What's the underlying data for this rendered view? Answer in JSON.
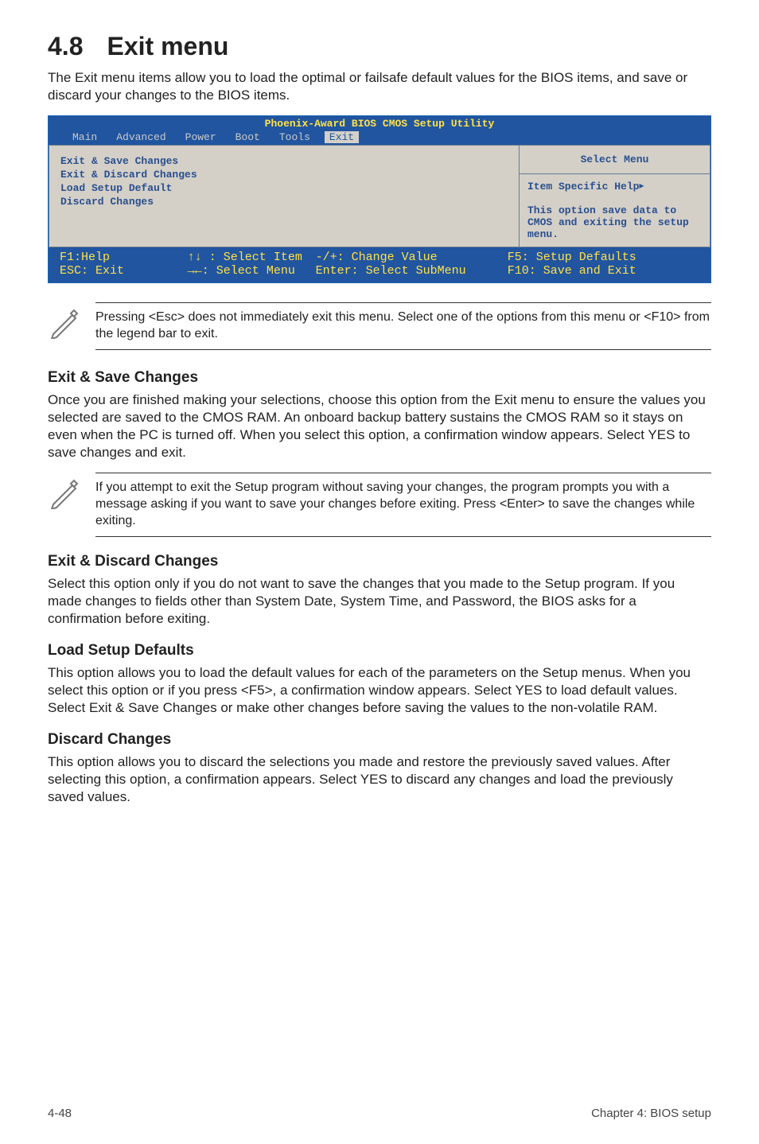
{
  "heading": {
    "number": "4.8",
    "title": "Exit menu"
  },
  "intro": "The Exit menu items allow you to load the optimal or failsafe default values for the BIOS items, and save or discard your changes to the BIOS items.",
  "bios": {
    "title": "Phoenix-Award BIOS CMOS Setup Utility",
    "tabs": [
      "Main",
      "Advanced",
      "Power",
      "Boot",
      "Tools",
      "Exit"
    ],
    "active_tab": "Exit",
    "options": [
      "Exit & Save Changes",
      "Exit & Discard Changes",
      "Load Setup Default",
      "Discard Changes"
    ],
    "help_title": "Select Menu",
    "help_item": "Item Specific Help",
    "help_desc": "This option save data to CMOS and exiting the setup menu.",
    "footer": {
      "f1": "F1:Help",
      "esc": "ESC: Exit",
      "sel_item": "↑↓ : Select Item",
      "sel_menu": "→←: Select Menu",
      "change": "-/+: Change Value",
      "enter": "Enter: Select SubMenu",
      "f5": "F5: Setup Defaults",
      "f10": "F10: Save and Exit"
    }
  },
  "note1": "Pressing <Esc> does not immediately exit this menu. Select one of the options from this menu or <F10> from the legend bar to exit.",
  "sections": {
    "s1": {
      "title": "Exit & Save Changes",
      "body": "Once you are finished making your selections, choose this option from the Exit menu to ensure the values you selected are saved to the CMOS RAM. An onboard backup battery sustains the CMOS RAM so it stays on even when the PC is turned off. When you select this option, a confirmation window appears. Select YES to save changes and exit."
    },
    "note2": " If you attempt to exit the Setup program without saving your changes, the program prompts you with a message asking if you want to save your changes before exiting. Press <Enter>  to save the  changes while exiting.",
    "s2": {
      "title": "Exit & Discard Changes",
      "body": "Select this option only if you do not want to save the changes that you  made to the Setup program. If you made changes to fields other than System Date, System Time, and Password, the BIOS asks for a confirmation before exiting."
    },
    "s3": {
      "title": "Load Setup Defaults",
      "body": "This option allows you to load the default values for each of the parameters on the Setup menus. When you select this option or if you press <F5>, a confirmation window appears. Select YES to load default values. Select Exit & Save Changes or make other changes before saving the values to the non-volatile RAM."
    },
    "s4": {
      "title": "Discard Changes",
      "body": "This option allows you to discard the selections you made and restore the previously saved values. After selecting this option, a confirmation appears. Select YES to discard any changes and load the previously saved values."
    }
  },
  "page_footer": {
    "left": "4-48",
    "right": "Chapter 4: BIOS setup"
  }
}
